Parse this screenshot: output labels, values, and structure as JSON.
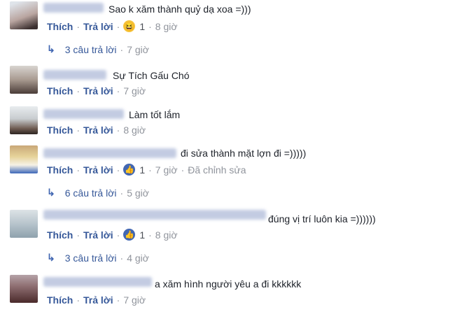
{
  "actions": {
    "like": "Thích",
    "reply": "Trả lời",
    "edited": "Đã chỉnh sửa"
  },
  "comments": [
    {
      "text": "Sao k xăm thành quỷ dạ xoa =)))",
      "reaction_count": "1",
      "reaction_icon": "haha-emoji-icon",
      "time": "8 giờ",
      "replies": {
        "label": "3 câu trả lời",
        "time": "7 giờ"
      }
    },
    {
      "text": "Sự Tích Gấu Chó",
      "time": "7 giờ"
    },
    {
      "text": "Làm tốt lắm",
      "time": "8 giờ"
    },
    {
      "text": "đi sửa thành mặt lợn đi =)))))",
      "reaction_count": "1",
      "reaction_icon": "like-icon",
      "time": "7 giờ",
      "replies": {
        "label": "6 câu trả lời",
        "time": "5 giờ"
      }
    },
    {
      "text": "đúng vị trí luôn kia =))))))",
      "reaction_count": "1",
      "reaction_icon": "like-icon",
      "time": "8 giờ",
      "replies": {
        "label": "3 câu trả lời",
        "time": "4 giờ"
      }
    },
    {
      "text": "a xăm hình người yêu a đi kkkkkk",
      "time": "7 giờ"
    }
  ],
  "colors": {
    "link": "#365899",
    "meta": "#90949c",
    "like_blue": "#4267b2",
    "text": "#1d2129"
  }
}
